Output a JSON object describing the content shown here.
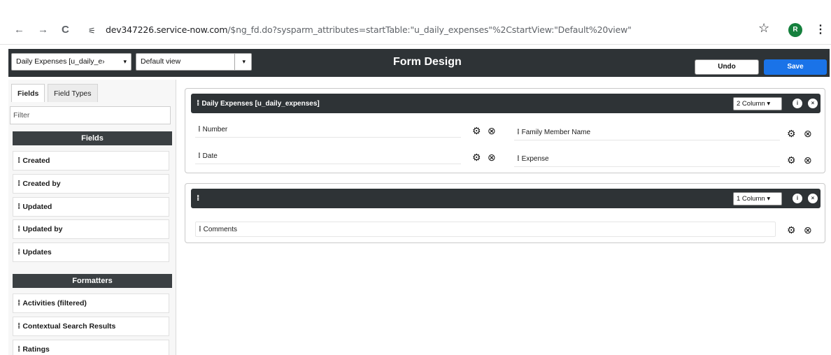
{
  "browser": {
    "nav_back": "←",
    "nav_forward": "→",
    "nav_reload": "C",
    "url_host": "dev347226.service-now.com",
    "url_path": "/$ng_fd.do?sysparm_attributes=startTable:\"u_daily_expenses\"%2CstartView:\"Default%20view\"",
    "profile_initial": "R"
  },
  "header": {
    "table_select": "Daily Expenses [u_daily_e›",
    "view_select": "Default view",
    "title": "Form Design",
    "undo_label": "Undo",
    "save_label": "Save",
    "accent_color": "#1a73e8"
  },
  "left_panel": {
    "tabs": [
      "Fields",
      "Field Types"
    ],
    "filter_placeholder": "Filter",
    "fields_heading": "Fields",
    "fields": [
      "Created",
      "Created by",
      "Updated",
      "Updated by",
      "Updates"
    ],
    "formatters_heading": "Formatters",
    "formatters": [
      "Activities (filtered)",
      "Contextual Search Results",
      "Ratings"
    ]
  },
  "sections": [
    {
      "title": "Daily Expenses [u_daily_expenses]",
      "columns": "2 Column",
      "fields_left": [
        "Number",
        "Date"
      ],
      "fields_right": [
        "Family Member Name",
        "Expense"
      ]
    },
    {
      "title": "",
      "columns": "1 Column",
      "fields": [
        "Comments"
      ]
    }
  ]
}
